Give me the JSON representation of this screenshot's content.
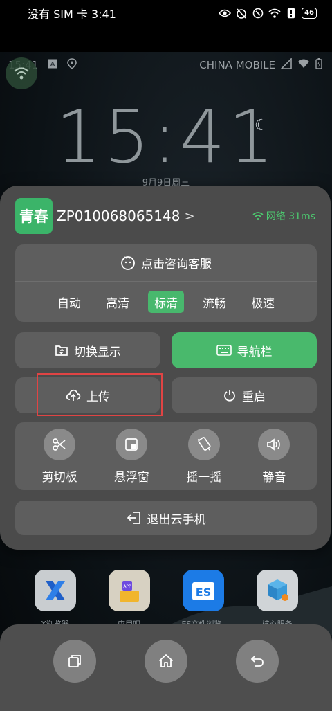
{
  "status_bar": {
    "carrier_time": "没有 SIM 卡 3:41",
    "battery": "46"
  },
  "remote": {
    "status_time": "15:41",
    "status_carrier": "CHINA MOBILE",
    "clock": "15:41",
    "date": "9月9日周三",
    "apps": [
      {
        "name": "X浏览器",
        "icon": "x-browser-icon"
      },
      {
        "name": "应用吧",
        "icon": "app-store-icon"
      },
      {
        "name": "ES文件浏览器",
        "icon": "es-file-icon"
      },
      {
        "name": "核心服务",
        "icon": "service-box-icon"
      }
    ]
  },
  "panel": {
    "brand": "青春",
    "device_id": "ZP010068065148",
    "chevron": ">",
    "network_label": "网络 31ms",
    "service_label": "点击咨询客服",
    "quality_options": [
      {
        "label": "自动",
        "active": false
      },
      {
        "label": "高清",
        "active": false
      },
      {
        "label": "标清",
        "active": true
      },
      {
        "label": "流畅",
        "active": false
      },
      {
        "label": "极速",
        "active": false
      }
    ],
    "switch_display": "切换显示",
    "nav_bar": "导航栏",
    "upload": "上传",
    "restart": "重启",
    "tools": [
      {
        "label": "剪切板",
        "icon": "scissors-icon"
      },
      {
        "label": "悬浮窗",
        "icon": "floating-window-icon"
      },
      {
        "label": "摇一摇",
        "icon": "shake-icon"
      },
      {
        "label": "静音",
        "icon": "speaker-icon"
      }
    ],
    "exit": "退出云手机"
  },
  "colors": {
    "accent_green": "#49b96c",
    "highlight_red": "#e04444",
    "panel_bg": "#4b4b4b"
  }
}
